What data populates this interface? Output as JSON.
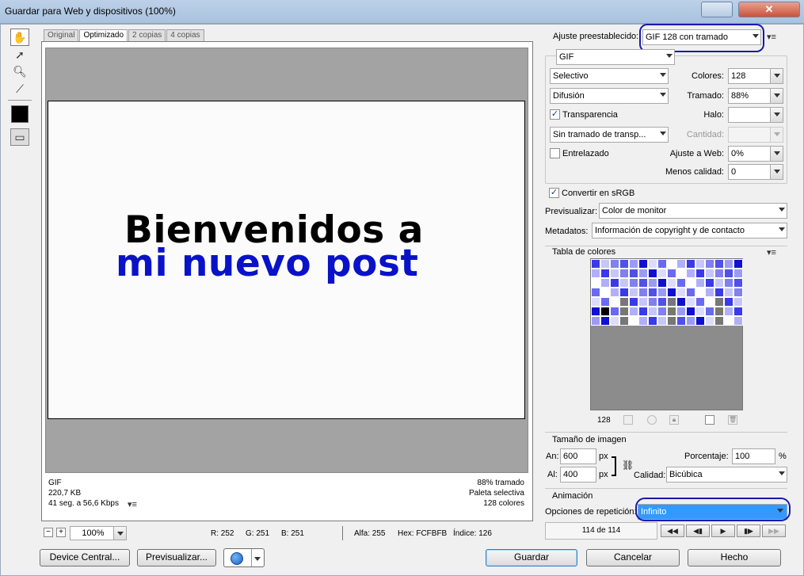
{
  "window": {
    "title": "Guardar para Web y dispositivos (100%)"
  },
  "tabs": [
    "Original",
    "Optimizado",
    "2 copias",
    "4 copias"
  ],
  "preview_image": {
    "line1": "Bienvenidos a",
    "line2": "mi nuevo post",
    "line2_color": "#0a12c8"
  },
  "image_info": {
    "format": "GIF",
    "size": "220,7 KB",
    "time": "41 seg. a 56,6 Kbps",
    "dither_info": "88% tramado",
    "palette_info": "Paleta selectiva",
    "colors_info": "128 colores"
  },
  "status_bar": {
    "zoom": "100%",
    "r": "R: 252",
    "g": "G: 251",
    "b": "B: 251",
    "alpha": "Alfa: 255",
    "hex": "Hex: FCFBFB",
    "index": "Índice: 126"
  },
  "settings": {
    "preset_label": "Ajuste preestablecido:",
    "preset_value": "GIF 128 con tramado",
    "format": "GIF",
    "reduction": "Selectivo",
    "colors_label": "Colores:",
    "colors_value": "128",
    "dither_algo": "Difusión",
    "dither_label": "Tramado:",
    "dither_value": "88%",
    "transparency_label": "Transparencia",
    "halo_label": "Halo:",
    "transp_dither": "Sin tramado de transp...",
    "amount_label": "Cantidad:",
    "interlaced_label": "Entrelazado",
    "web_snap_label": "Ajuste a Web:",
    "web_snap_value": "0%",
    "lossy_label": "Menos calidad:",
    "lossy_value": "0",
    "srgb_label": "Convertir en sRGB",
    "preview_label": "Previsualizar:",
    "preview_value": "Color de monitor",
    "metadata_label": "Metadatos:",
    "metadata_value": "Información de copyright y de contacto"
  },
  "color_table": {
    "title": "Tabla de colores",
    "count": "128"
  },
  "image_size": {
    "title": "Tamaño de imagen",
    "width_label": "An:",
    "width_value": "600",
    "height_label": "Al:",
    "height_value": "400",
    "unit": "px",
    "percent_label": "Porcentaje:",
    "percent_value": "100",
    "percent_unit": "%",
    "quality_label": "Calidad:",
    "quality_value": "Bicúbica"
  },
  "animation": {
    "title": "Animación",
    "loop_label": "Opciones de repetición:",
    "loop_value": "Infinito",
    "frame_counter": "114 de 114"
  },
  "buttons": {
    "device_central": "Device Central...",
    "preview": "Previsualizar...",
    "save": "Guardar",
    "cancel": "Cancelar",
    "done": "Hecho"
  },
  "palette_colors": [
    "#3a3ae8",
    "#6a6af0",
    "#9b9bf5",
    "#c6c6fa",
    "#ffffff",
    "#1010d0",
    "#8080ee",
    "#b0b0f8",
    "#dcdcfc",
    "#5050ea"
  ],
  "annotation_color": "#1b1ba8"
}
